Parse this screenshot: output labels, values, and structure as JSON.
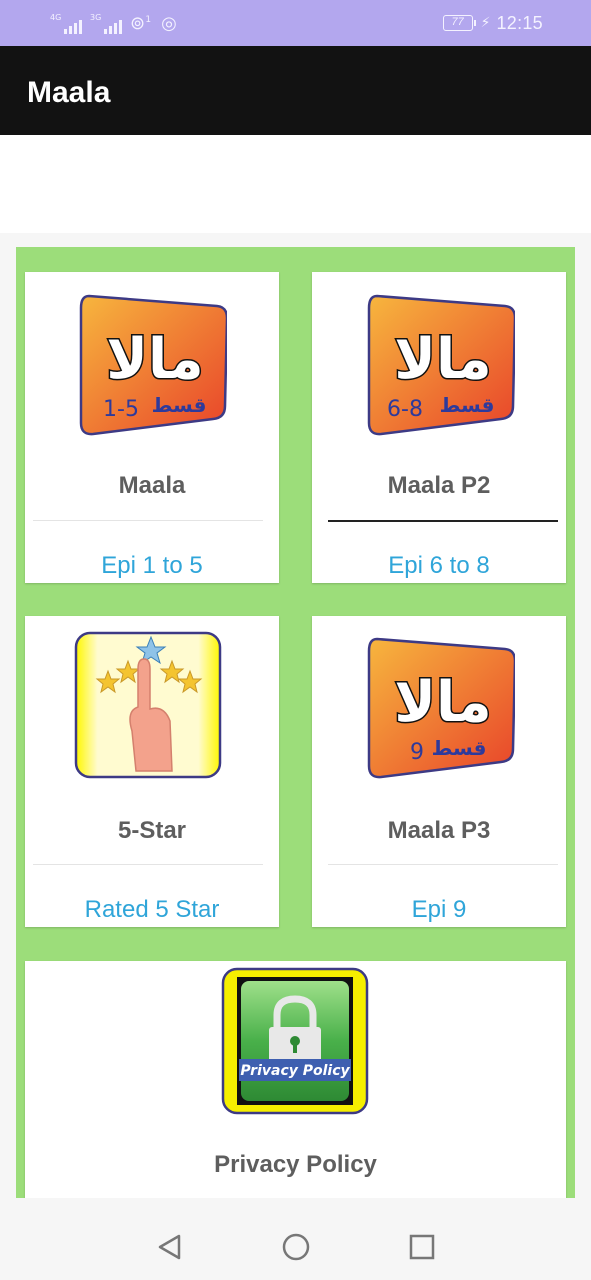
{
  "status_bar": {
    "sim1_label": "4G",
    "sim2_label": "3G",
    "hotspot_badge": "1",
    "battery_level": "77",
    "time": "12:15"
  },
  "app_bar": {
    "title": "Maala"
  },
  "cards": [
    {
      "title": "Maala",
      "subtitle": "Epi 1 to 5",
      "thumb_caption": "قسط",
      "thumb_number": "1-5",
      "icon": "maala-logo-icon"
    },
    {
      "title": "Maala P2",
      "subtitle": "Epi 6 to 8",
      "thumb_caption": "قسط",
      "thumb_number": "6-8",
      "icon": "maala-logo-icon"
    },
    {
      "title": "5-Star",
      "subtitle": "Rated 5 Star",
      "icon": "five-star-rating-icon"
    },
    {
      "title": "Maala P3",
      "subtitle": "Epi 9",
      "thumb_caption": "قسط",
      "thumb_number": "9",
      "icon": "maala-logo-icon"
    },
    {
      "title": "Privacy Policy",
      "thumb_label": "Privacy Policy",
      "icon": "privacy-lock-icon"
    }
  ],
  "logo_text": "مالا",
  "nav_bar": {
    "buttons": [
      "back-icon",
      "home-icon",
      "recents-icon"
    ]
  },
  "colors": {
    "status_bar": "#b3a7ee",
    "app_bar": "#121212",
    "grid_background": "#9cdd7a",
    "title_text": "#5e5e5e",
    "subtitle_text": "#2fa5d9",
    "logo_orange": "#f2a13a",
    "logo_red": "#e8432a"
  }
}
